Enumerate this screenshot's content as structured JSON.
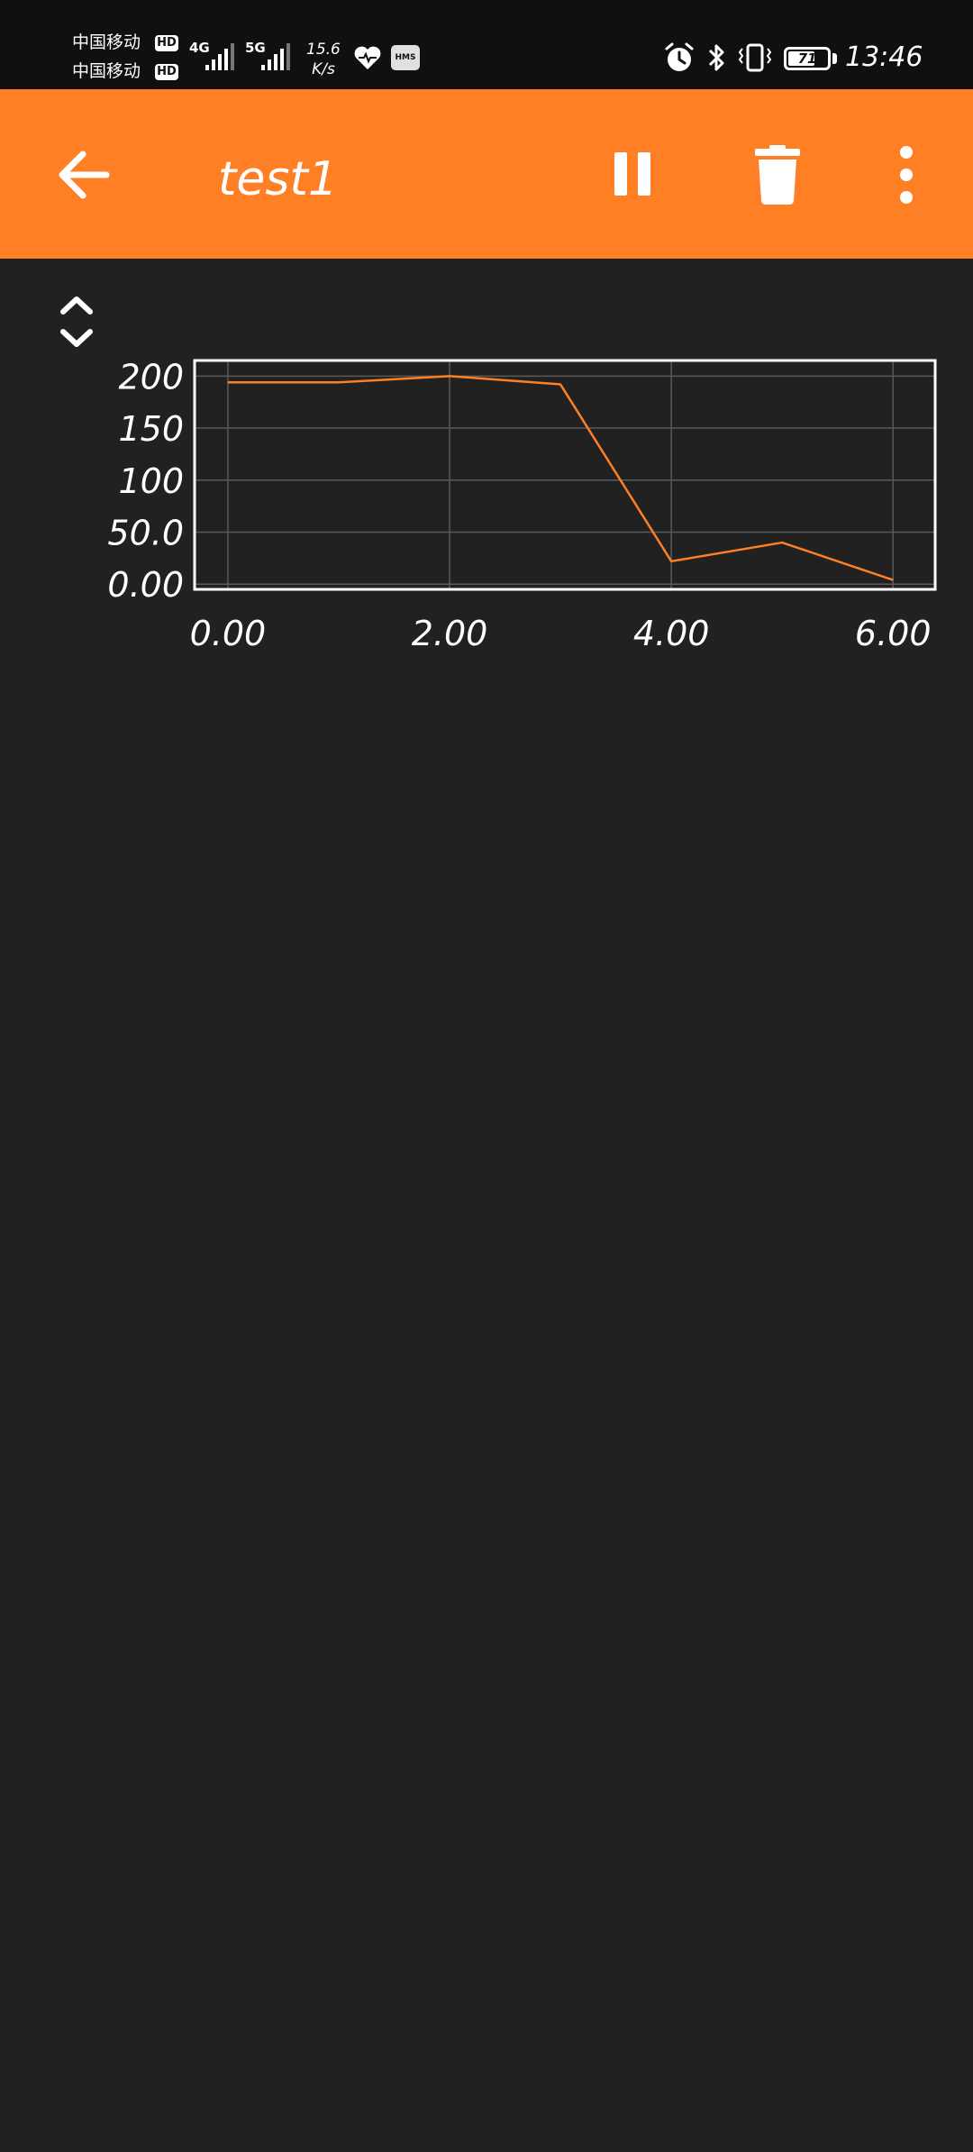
{
  "status_bar": {
    "carrier_1": "中国移动",
    "carrier_2": "中国移动",
    "hd_badge": "HD",
    "network_1": "4G",
    "network_2": "5G",
    "speed_value": "15.6",
    "speed_unit": "K/s",
    "hms_badge": "HMS",
    "battery_level": "71",
    "battery_percent": 71,
    "time": "13:46"
  },
  "app_bar": {
    "title": "test1",
    "background_color": "#ff7f24",
    "icons": [
      "back-arrow-icon",
      "pause-icon",
      "delete-icon",
      "more-vert-icon"
    ]
  },
  "chart_data": {
    "type": "line",
    "x": [
      0,
      1,
      2,
      3,
      4,
      5,
      6
    ],
    "series": [
      {
        "values": [
          194,
          194,
          200,
          192,
          22,
          40,
          4
        ],
        "color": "#ff7f24"
      }
    ],
    "xlim": [
      -0.3,
      6.38
    ],
    "ylim": [
      -5,
      215
    ],
    "x_ticks": [
      0,
      2,
      4,
      6
    ],
    "x_tick_labels": [
      "0.00",
      "2.00",
      "4.00",
      "6.00"
    ],
    "y_ticks": [
      0,
      50,
      100,
      150,
      200
    ],
    "y_tick_labels": [
      "0.00",
      "50.0",
      "100",
      "150",
      "200"
    ],
    "grid": true,
    "title": "",
    "xlabel": "",
    "ylabel": ""
  }
}
